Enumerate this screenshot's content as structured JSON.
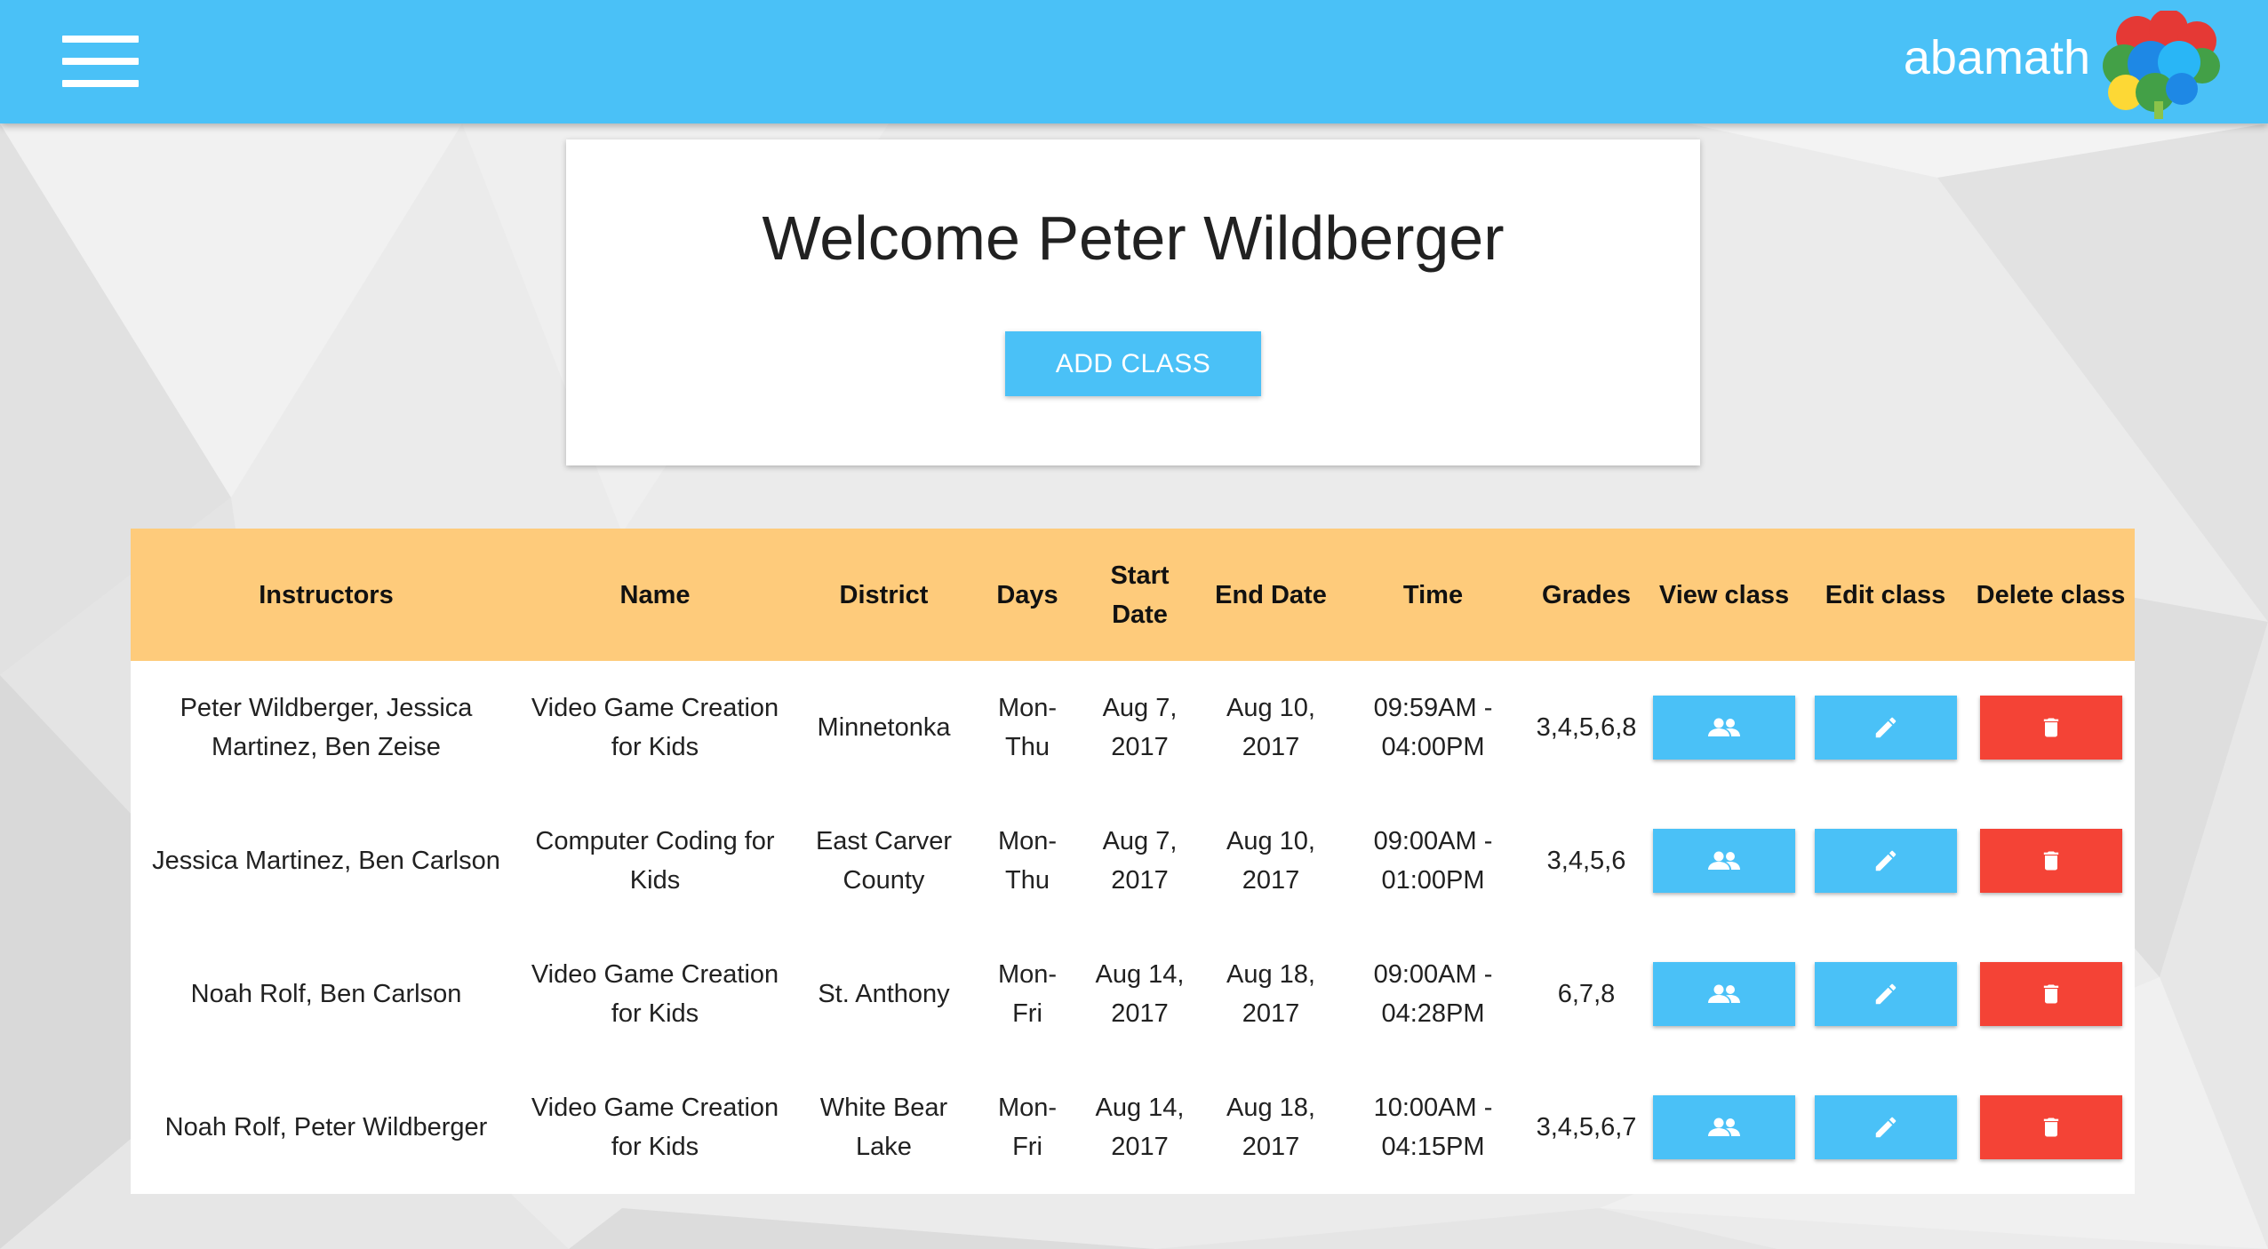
{
  "colors": {
    "accent": "#4ac1f7",
    "header_row": "#fecb7b",
    "danger": "#f44336"
  },
  "appbar": {
    "brand": "abamath",
    "menu_icon": "hamburger-menu-icon",
    "logo": "colorful-brain-logo"
  },
  "welcome": {
    "title": "Welcome Peter Wildberger",
    "add_class_label": "ADD CLASS"
  },
  "table": {
    "columns": [
      "Instructors",
      "Name",
      "District",
      "Days",
      "Start Date",
      "End Date",
      "Time",
      "Grades",
      "View class",
      "Edit class",
      "Delete class"
    ],
    "rows": [
      {
        "instructors": "Peter Wildberger, Jessica Martinez, Ben Zeise",
        "name": "Video Game Creation for Kids",
        "district": "Minnetonka",
        "days": "Mon-Thu",
        "start_date": "Aug 7, 2017",
        "end_date": "Aug 10, 2017",
        "time": "09:59AM - 04:00PM",
        "grades": "3,4,5,6,8"
      },
      {
        "instructors": "Jessica Martinez, Ben Carlson",
        "name": "Computer Coding for Kids",
        "district": "East Carver County",
        "days": "Mon-Thu",
        "start_date": "Aug 7, 2017",
        "end_date": "Aug 10, 2017",
        "time": "09:00AM - 01:00PM",
        "grades": "3,4,5,6"
      },
      {
        "instructors": "Noah Rolf, Ben Carlson",
        "name": "Video Game Creation for Kids",
        "district": "St. Anthony",
        "days": "Mon-Fri",
        "start_date": "Aug 14, 2017",
        "end_date": "Aug 18, 2017",
        "time": "09:00AM - 04:28PM",
        "grades": "6,7,8"
      },
      {
        "instructors": "Noah Rolf, Peter Wildberger",
        "name": "Video Game Creation for Kids",
        "district": "White Bear Lake",
        "days": "Mon-Fri",
        "start_date": "Aug 14, 2017",
        "end_date": "Aug 18, 2017",
        "time": "10:00AM - 04:15PM",
        "grades": "3,4,5,6,7"
      }
    ],
    "action_icons": {
      "view": "people-icon",
      "edit": "pencil-icon",
      "delete": "trash-icon"
    }
  }
}
